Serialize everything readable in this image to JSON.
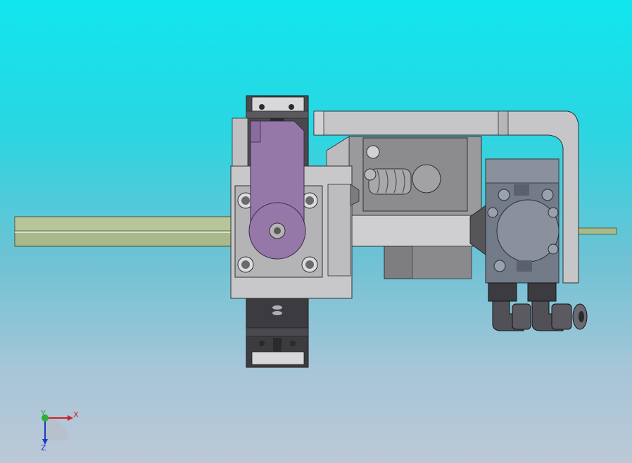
{
  "viewport": {
    "background_top": "#12e6ee",
    "background_bottom": "#bcc8d6"
  },
  "triad": {
    "x_label": "X",
    "y_label": "Y",
    "z_label": "Z",
    "x_color": "#d0202a",
    "y_color": "#2fae3a",
    "z_color": "#1a3ac8"
  },
  "model": {
    "rail_color": "#a9b98c",
    "housing_color": "#c8c8ca",
    "lever_color": "#9678a8",
    "cylinder_color": "#737a88",
    "block_color": "#3c3c40"
  }
}
